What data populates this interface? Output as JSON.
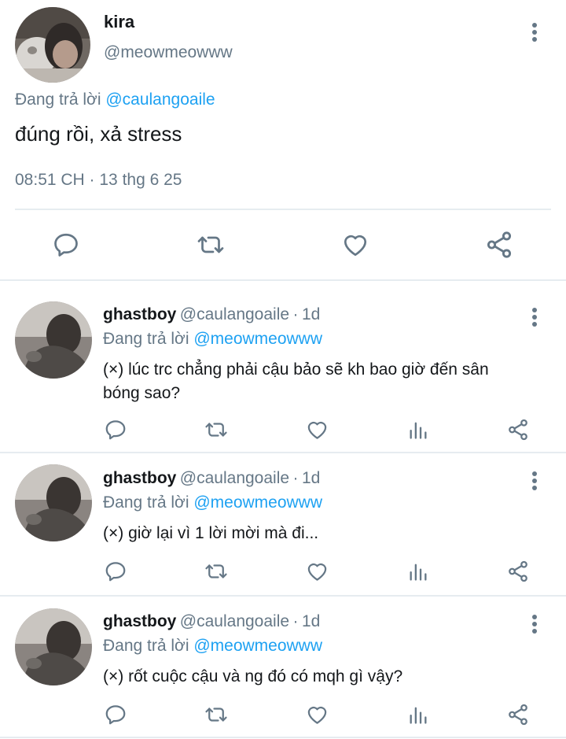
{
  "main_tweet": {
    "author_name": "kira",
    "author_handle": "@meowmeowww",
    "replying_prefix": "Đang trả lời",
    "replying_to": "@caulangoaile",
    "text": "đúng rồi, xả stress",
    "timestamp": "08:51 CH · 13 thg 6 25",
    "actions": [
      "reply-icon",
      "retweet-icon",
      "like-icon",
      "share-icon"
    ]
  },
  "replies": [
    {
      "author_name": "ghastboy",
      "author_handle": "@caulangoaile",
      "separator": "·",
      "age": "1d",
      "replying_prefix": "Đang trả lời",
      "replying_to": "@meowmeowww",
      "text": "(×) lúc trc chẳng phải cậu bảo sẽ kh bao giờ đến sân bóng sao?"
    },
    {
      "author_name": "ghastboy",
      "author_handle": "@caulangoaile",
      "separator": "·",
      "age": "1d",
      "replying_prefix": "Đang trả lời",
      "replying_to": "@meowmeowww",
      "text": "(×) giờ lại vì 1 lời mời mà đi..."
    },
    {
      "author_name": "ghastboy",
      "author_handle": "@caulangoaile",
      "separator": "·",
      "age": "1d",
      "replying_prefix": "Đang trả lời",
      "replying_to": "@meowmeowww",
      "text": "(×) rốt cuộc cậu và ng đó có mqh gì vậy?"
    }
  ],
  "colors": {
    "link": "#1da1f2",
    "secondary_text": "#657786",
    "icon": "#657786",
    "divider": "#e6ecf0"
  }
}
